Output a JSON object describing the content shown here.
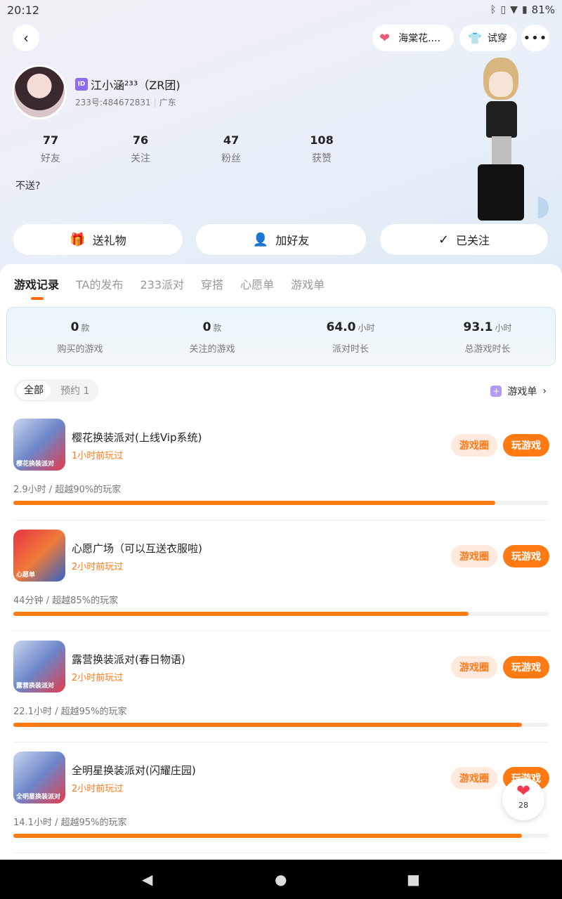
{
  "status": {
    "time": "20:12",
    "battery": "81%"
  },
  "topbar": {
    "haitang": "海棠花....",
    "try_on": "试穿"
  },
  "profile": {
    "name": "江小涵²³³（ZR团)",
    "id_badge": "ID",
    "uid": "233号:484672831",
    "region": "广东",
    "signature": "不送?"
  },
  "stats": [
    {
      "num": "77",
      "label": "好友"
    },
    {
      "num": "76",
      "label": "关注"
    },
    {
      "num": "47",
      "label": "粉丝"
    },
    {
      "num": "108",
      "label": "获赞"
    }
  ],
  "actions": {
    "gift": "送礼物",
    "add_friend": "加好友",
    "followed": "已关注"
  },
  "tabs": [
    "游戏记录",
    "TA的发布",
    "233派对",
    "穿搭",
    "心愿单",
    "游戏单"
  ],
  "summary": [
    {
      "value": "0",
      "unit": "款",
      "label": "购买的游戏"
    },
    {
      "value": "0",
      "unit": "款",
      "label": "关注的游戏"
    },
    {
      "value": "64.0",
      "unit": "小时",
      "label": "派对时长"
    },
    {
      "value": "93.1",
      "unit": "小时",
      "label": "总游戏时长"
    }
  ],
  "filter": {
    "all": "全部",
    "reserved": "预约 1",
    "gamelist": "游戏单"
  },
  "games": [
    {
      "name": "樱花换装派对(上线Vip系统)",
      "last_played": "1小时前玩过",
      "stat": "2.9小时 / 超越90%的玩家",
      "progress": 0.9,
      "circle": "游戏圈",
      "play": "玩游戏",
      "thumb_text": "樱花换装派对"
    },
    {
      "name": "心愿广场（可以互送衣服啦)",
      "last_played": "2小时前玩过",
      "stat": "44分钟 / 超越85%的玩家",
      "progress": 0.85,
      "circle": "游戏圈",
      "play": "玩游戏",
      "thumb_text": "心愿单"
    },
    {
      "name": "露营换装派对(春日物语)",
      "last_played": "2小时前玩过",
      "stat": "22.1小时 / 超越95%的玩家",
      "progress": 0.95,
      "circle": "游戏圈",
      "play": "玩游戏",
      "thumb_text": "露营换装派对"
    },
    {
      "name": "全明星换装派对(闪耀庄园)",
      "last_played": "2小时前玩过",
      "stat": "14.1小时 / 超越95%的玩家",
      "progress": 0.95,
      "circle": "游戏圈",
      "play": "玩游戏",
      "thumb_text": "全明星换装派对"
    }
  ],
  "like_count": "28"
}
